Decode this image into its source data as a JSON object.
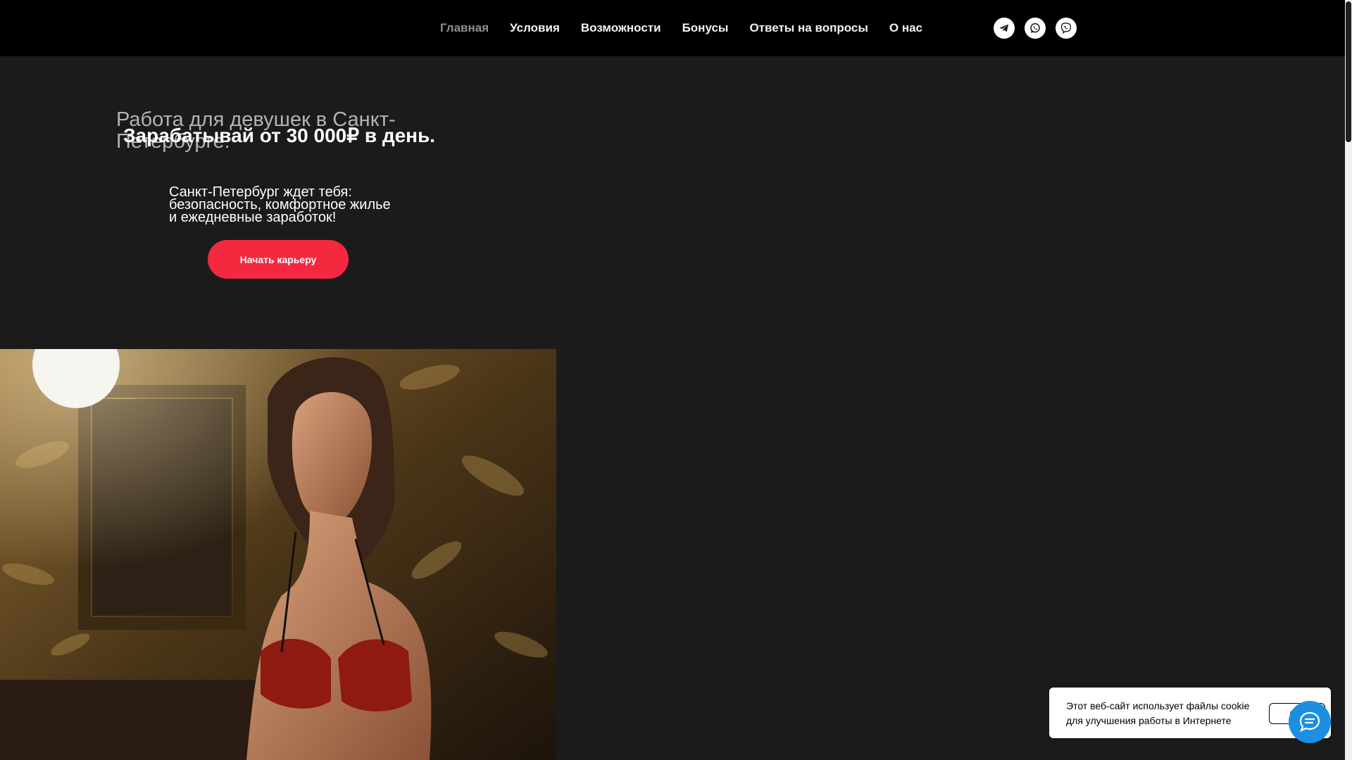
{
  "header": {
    "nav": [
      {
        "label": "Главная",
        "active": true
      },
      {
        "label": "Условия"
      },
      {
        "label": "Возможности"
      },
      {
        "label": "Бонусы"
      },
      {
        "label": "Ответы на вопросы"
      },
      {
        "label": "О нас"
      }
    ],
    "socials": [
      "telegram-icon",
      "whatsapp-icon",
      "viber-icon"
    ]
  },
  "hero": {
    "title": "Работа для девушек в Санкт-Петербурге.",
    "subtitle": "Зарабатывай от 30 000₽ в день.",
    "description": "Санкт-Петербург ждет тебя: безопасность, комфортное жилье и ежедневные заработок!",
    "cta_label": "Начать карьеру"
  },
  "cookie": {
    "text": "Этот веб-сайт использует файлы cookie для улучшения работы в Интернете",
    "ok_label": "OK"
  },
  "chat": {
    "icon": "chat-icon"
  },
  "colors": {
    "accent": "#f4283f",
    "header_bg": "#000000",
    "page_bg": "#1c1b1b",
    "chat": "#1d8fe1"
  }
}
